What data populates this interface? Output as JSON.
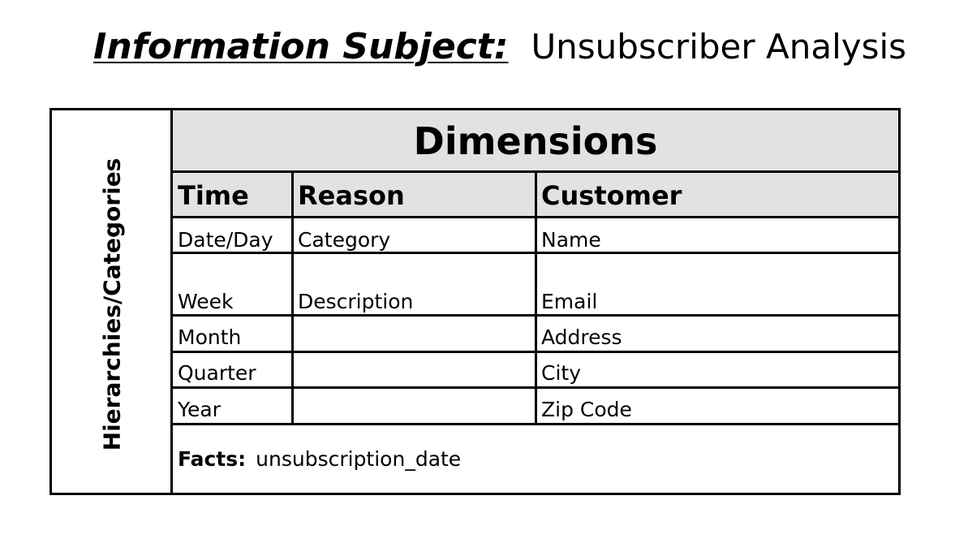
{
  "title": {
    "label": "Information Subject:",
    "value": "Unsubscriber  Analysis"
  },
  "side_label": "Hierarchies/Categories",
  "header": "Dimensions",
  "columns": [
    {
      "header": "Time",
      "cells": [
        "Date/Day",
        "Week",
        "Month",
        "Quarter",
        "Year"
      ]
    },
    {
      "header": "Reason",
      "cells": [
        "Category",
        "Description",
        "",
        "",
        ""
      ]
    },
    {
      "header": "Customer",
      "cells": [
        "Name",
        "Email",
        "Address",
        "City",
        "Zip Code"
      ]
    }
  ],
  "facts": {
    "label": "Facts:",
    "value": "unsubscription_date"
  }
}
